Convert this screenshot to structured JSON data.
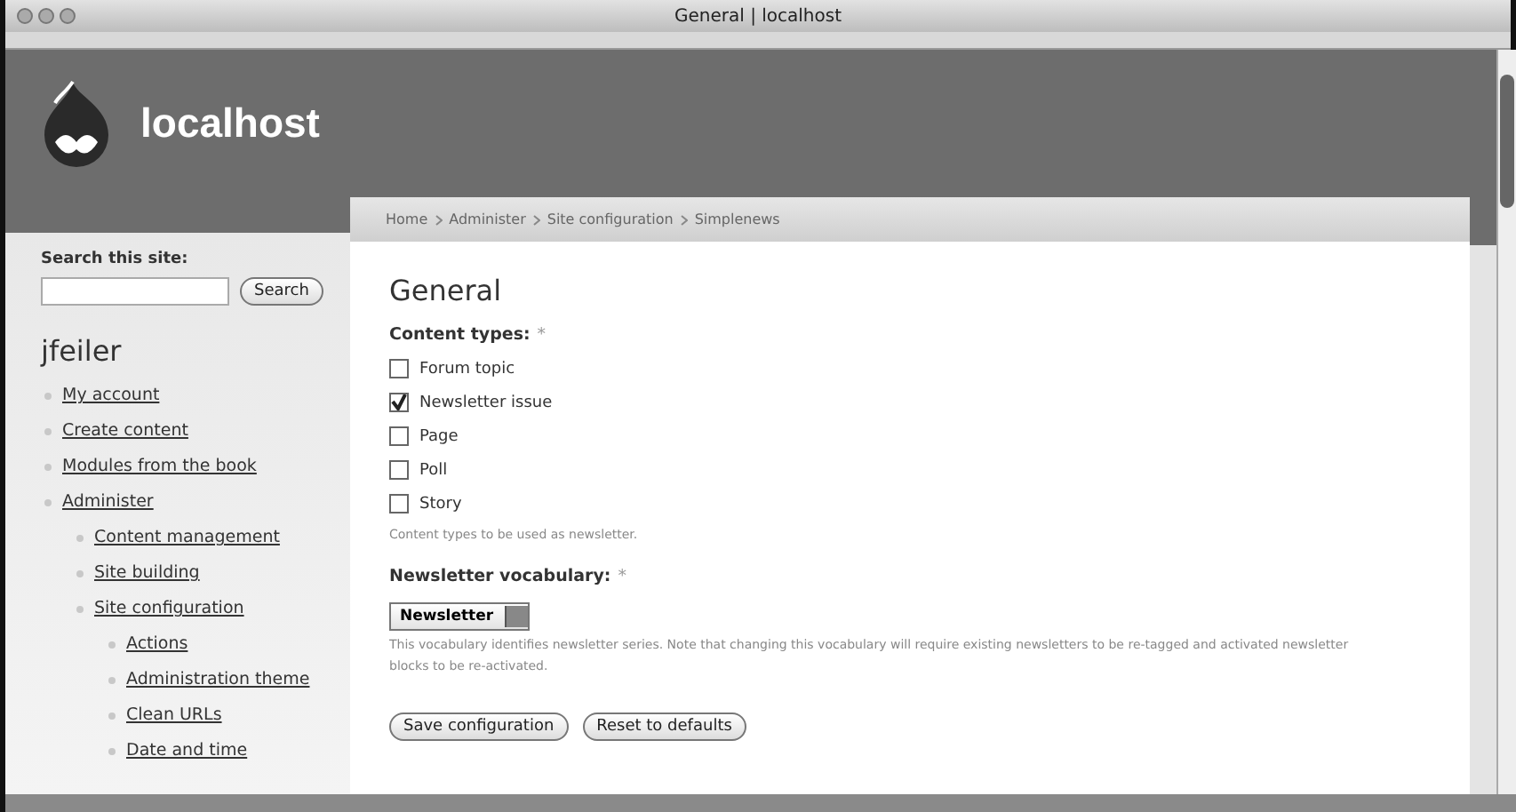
{
  "window": {
    "title": "General | localhost"
  },
  "site": {
    "name": "localhost"
  },
  "search": {
    "label": "Search this site:",
    "button": "Search"
  },
  "user": {
    "name": "jfeiler"
  },
  "nav": [
    {
      "label": "My account"
    },
    {
      "label": "Create content"
    },
    {
      "label": "Modules from the book"
    },
    {
      "label": "Administer",
      "children": [
        {
          "label": "Content management"
        },
        {
          "label": "Site building"
        },
        {
          "label": "Site configuration",
          "children": [
            {
              "label": "Actions"
            },
            {
              "label": "Administration theme"
            },
            {
              "label": "Clean URLs"
            },
            {
              "label": "Date and time"
            }
          ]
        }
      ]
    }
  ],
  "breadcrumb": [
    "Home",
    "Administer",
    "Site configuration",
    "Simplenews"
  ],
  "page": {
    "title": "General"
  },
  "content_types": {
    "label": "Content types:",
    "required": "*",
    "options": [
      {
        "label": "Forum topic",
        "checked": false
      },
      {
        "label": "Newsletter issue",
        "checked": true
      },
      {
        "label": "Page",
        "checked": false
      },
      {
        "label": "Poll",
        "checked": false
      },
      {
        "label": "Story",
        "checked": false
      }
    ],
    "help": "Content types to be used as newsletter."
  },
  "vocabulary": {
    "label": "Newsletter vocabulary:",
    "required": "*",
    "value": "Newsletter",
    "help": "This vocabulary identifies newsletter series. Note that changing this vocabulary will require existing newsletters to be re-tagged and activated newsletter blocks to be re-activated."
  },
  "buttons": [
    "Save configuration",
    "Reset to defaults"
  ]
}
